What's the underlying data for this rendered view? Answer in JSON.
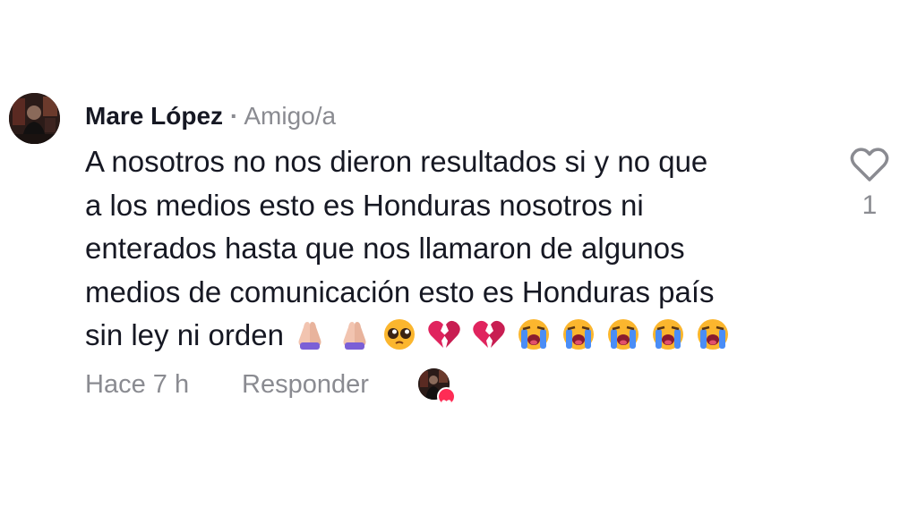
{
  "comment": {
    "author": "Mare López",
    "separator": "·",
    "relation": "Amigo/a",
    "lines": [
      "A nosotros no nos dieron resultados si y no que",
      "a los medios esto es Honduras nosotros ni",
      "enterados hasta que nos llamaron de algunos",
      "medios de comunicación esto es Honduras país",
      "sin ley ni orden"
    ],
    "emojis": [
      "folded-hands",
      "folded-hands",
      "pleading-face",
      "broken-heart",
      "broken-heart",
      "loudly-crying-face",
      "loudly-crying-face",
      "loudly-crying-face",
      "loudly-crying-face",
      "loudly-crying-face"
    ],
    "time": "Hace 7 h",
    "reply_label": "Responder",
    "like_count": "1"
  },
  "colors": {
    "text_primary": "#161823",
    "text_secondary": "#8a8b91",
    "like_red": "#fe2c55",
    "background": "#ffffff"
  },
  "icons": {
    "like": "heart-outline-icon",
    "liked_by_badge": "heart-badge-icon"
  }
}
